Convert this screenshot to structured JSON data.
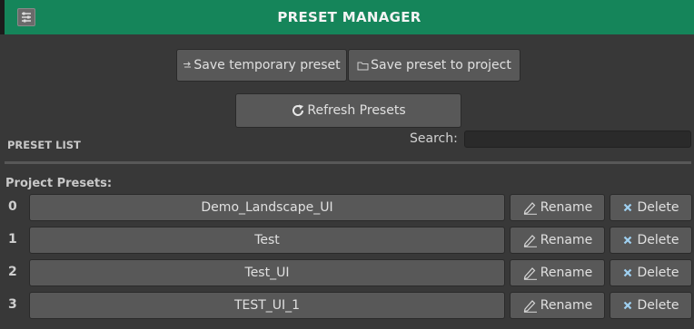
{
  "header": {
    "title": "PRESET MANAGER",
    "icon": "sliders-icon",
    "bar_color": "#15855a"
  },
  "toolbar": {
    "save_temp_label": "Save temporary preset",
    "save_project_label": "Save preset to project",
    "refresh_label": "Refresh Presets"
  },
  "preset_list": {
    "title": "PRESET LIST",
    "search_label": "Search:",
    "search_value": ""
  },
  "project_presets": {
    "label": "Project Presets:",
    "rename_label": "Rename",
    "delete_label": "Delete",
    "items": [
      {
        "index": "0",
        "name": "Demo_Landscape_UI"
      },
      {
        "index": "1",
        "name": "Test"
      },
      {
        "index": "2",
        "name": "Test_UI"
      },
      {
        "index": "3",
        "name": "TEST_UI_1"
      }
    ]
  }
}
